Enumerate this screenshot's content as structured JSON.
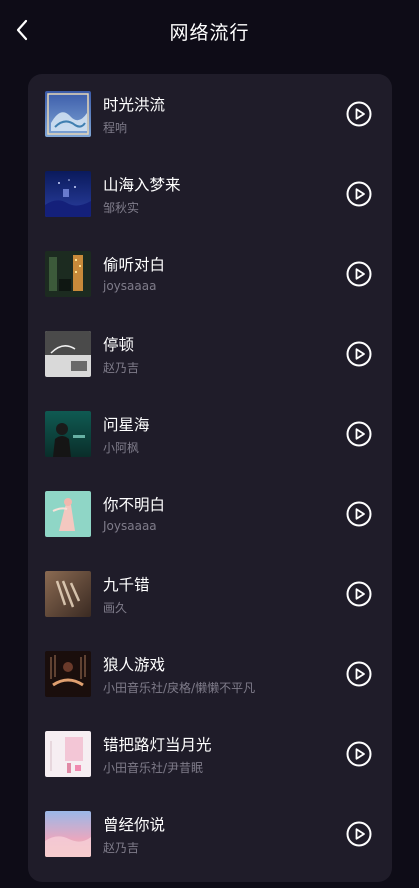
{
  "header": {
    "title": "网络流行"
  },
  "songs": [
    {
      "title": "时光洪流",
      "artist": "程响"
    },
    {
      "title": "山海入梦来",
      "artist": "邹秋实"
    },
    {
      "title": "偷听对白",
      "artist": "joysaaaa"
    },
    {
      "title": "停顿",
      "artist": "赵乃吉"
    },
    {
      "title": "问星海",
      "artist": "小阿枫"
    },
    {
      "title": "你不明白",
      "artist": "Joysaaaa"
    },
    {
      "title": "九千错",
      "artist": "画久"
    },
    {
      "title": "狼人游戏",
      "artist": "小田音乐社/戾格/懒懒不平凡"
    },
    {
      "title": "错把路灯当月光",
      "artist": "小田音乐社/尹昔眠"
    },
    {
      "title": "曾经你说",
      "artist": "赵乃吉"
    }
  ],
  "icons": {
    "back": "chevron-left-icon",
    "play": "play-circle-icon"
  },
  "colors": {
    "background": "#0e0c17",
    "card": "#1f1c29",
    "title_text": "#ffffff",
    "subtitle_text": "#7f7c8a"
  }
}
